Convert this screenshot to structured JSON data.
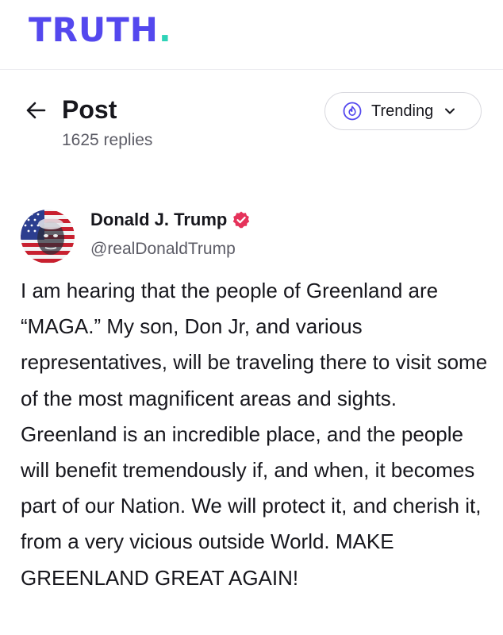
{
  "app": {
    "logo_text": "TRUTH",
    "logo_dot": "."
  },
  "colors": {
    "brand": "#5448ee",
    "brand_accent": "#2ed3b7",
    "verified": "#e5325a"
  },
  "post_header": {
    "back_icon": "arrow-left-icon",
    "title": "Post",
    "replies": "1625 replies",
    "sort": {
      "icon": "flame-icon",
      "label": "Trending",
      "chevron": "chevron-down-icon"
    }
  },
  "post": {
    "author_name": "Donald J. Trump",
    "author_handle": "@realDonaldTrump",
    "verified_icon": "verified-badge-icon",
    "text": "I am hearing that the people of Greenland are “MAGA.” My son, Don Jr, and various representatives, will be traveling there to visit some of the most magnificent areas and sights. Greenland is an incredible place, and the people will benefit tremendously if, and when, it becomes part of our Nation. We will protect it, and cherish it, from a very vicious outside World. MAKE GREENLAND GREAT AGAIN!"
  }
}
